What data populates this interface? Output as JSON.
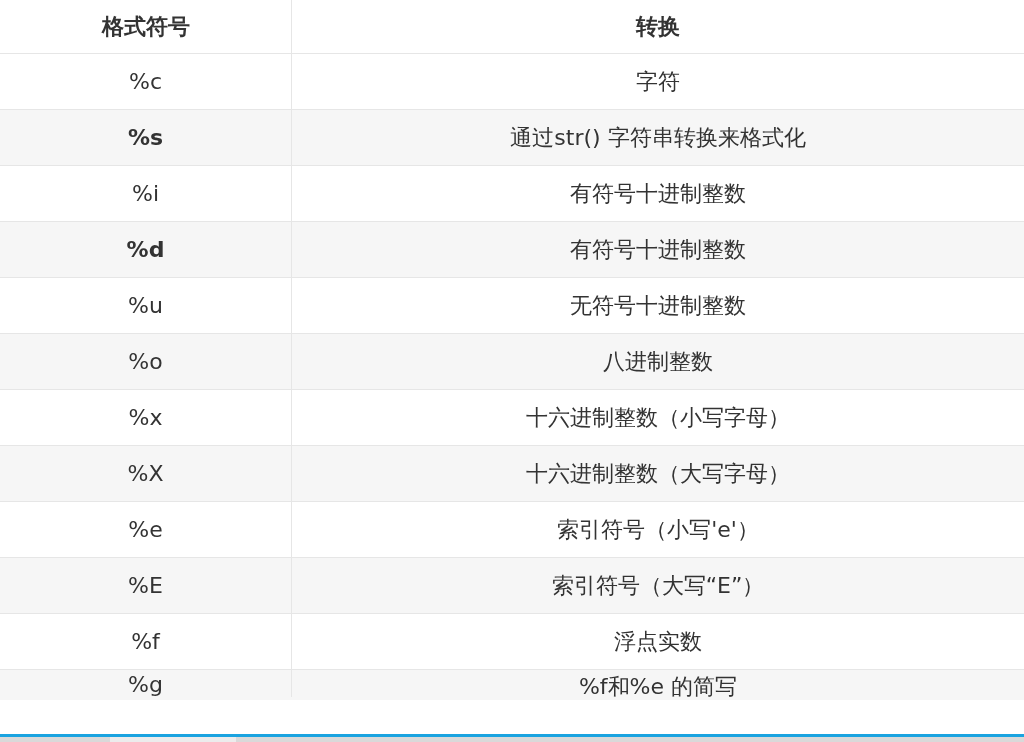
{
  "table": {
    "columns": [
      "格式符号",
      "转换"
    ],
    "rows": [
      {
        "symbol": "%c",
        "conversion": "字符",
        "bold": false
      },
      {
        "symbol": "%s",
        "conversion": "通过str() 字符串转换来格式化",
        "bold": true
      },
      {
        "symbol": "%i",
        "conversion": "有符号十进制整数",
        "bold": false
      },
      {
        "symbol": "%d",
        "conversion": "有符号十进制整数",
        "bold": true
      },
      {
        "symbol": "%u",
        "conversion": "无符号十进制整数",
        "bold": false
      },
      {
        "symbol": "%o",
        "conversion": "八进制整数",
        "bold": false
      },
      {
        "symbol": "%x",
        "conversion": "十六进制整数（小写字母）",
        "bold": false
      },
      {
        "symbol": "%X",
        "conversion": "十六进制整数（大写字母）",
        "bold": false
      },
      {
        "symbol": "%e",
        "conversion": "索引符号（小写'e'）",
        "bold": false
      },
      {
        "symbol": "%E",
        "conversion": "索引符号（大写“E”）",
        "bold": false
      },
      {
        "symbol": "%f",
        "conversion": "浮点实数",
        "bold": false
      },
      {
        "symbol": "%g",
        "conversion": "%f和%e 的简写",
        "bold": false
      }
    ]
  }
}
